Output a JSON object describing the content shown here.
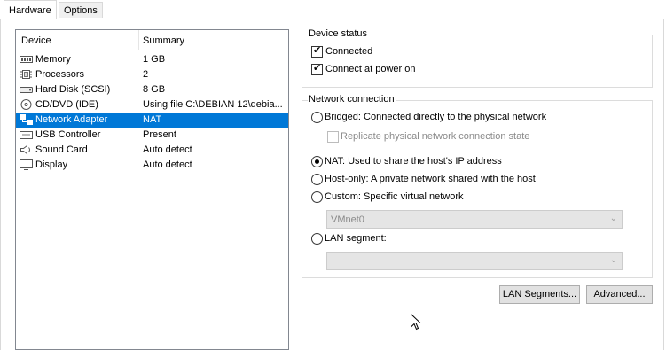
{
  "tabs": [
    {
      "label": "Hardware",
      "active": true
    },
    {
      "label": "Options",
      "active": false
    }
  ],
  "device_list": {
    "col_device": "Device",
    "col_summary": "Summary",
    "rows": [
      {
        "icon": "memory-icon",
        "name": "Memory",
        "summary": "1 GB"
      },
      {
        "icon": "processor-icon",
        "name": "Processors",
        "summary": "2"
      },
      {
        "icon": "hard-disk-icon",
        "name": "Hard Disk (SCSI)",
        "summary": "8 GB"
      },
      {
        "icon": "cd-dvd-icon",
        "name": "CD/DVD (IDE)",
        "summary": "Using file C:\\DEBIAN 12\\debia..."
      },
      {
        "icon": "network-adapter-icon",
        "name": "Network Adapter",
        "summary": "NAT"
      },
      {
        "icon": "usb-icon",
        "name": "USB Controller",
        "summary": "Present"
      },
      {
        "icon": "sound-card-icon",
        "name": "Sound Card",
        "summary": "Auto detect"
      },
      {
        "icon": "display-icon",
        "name": "Display",
        "summary": "Auto detect"
      }
    ],
    "selected": "Network Adapter"
  },
  "device_status": {
    "title": "Device status",
    "connected": {
      "label": "Connected",
      "checked": true
    },
    "connect_at_power_on": {
      "label": "Connect at power on",
      "checked": true
    }
  },
  "network_connection": {
    "title": "Network connection",
    "bridged": {
      "label": "Bridged: Connected directly to the physical network",
      "selected": false
    },
    "replicate": {
      "label": "Replicate physical network connection state",
      "checked": false,
      "enabled": false
    },
    "nat": {
      "label": "NAT: Used to share the host's IP address",
      "selected": true
    },
    "host_only": {
      "label": "Host-only: A private network shared with the host",
      "selected": false
    },
    "custom": {
      "label": "Custom: Specific virtual network",
      "selected": false
    },
    "custom_value": "VMnet0",
    "lan_segment": {
      "label": "LAN segment:",
      "selected": false
    },
    "lan_segment_value": ""
  },
  "buttons": {
    "lan_segments": "LAN Segments...",
    "advanced": "Advanced..."
  },
  "colors": {
    "selection": "#0078d7",
    "disabled_text": "#8a8a8a",
    "border": "#828790"
  }
}
